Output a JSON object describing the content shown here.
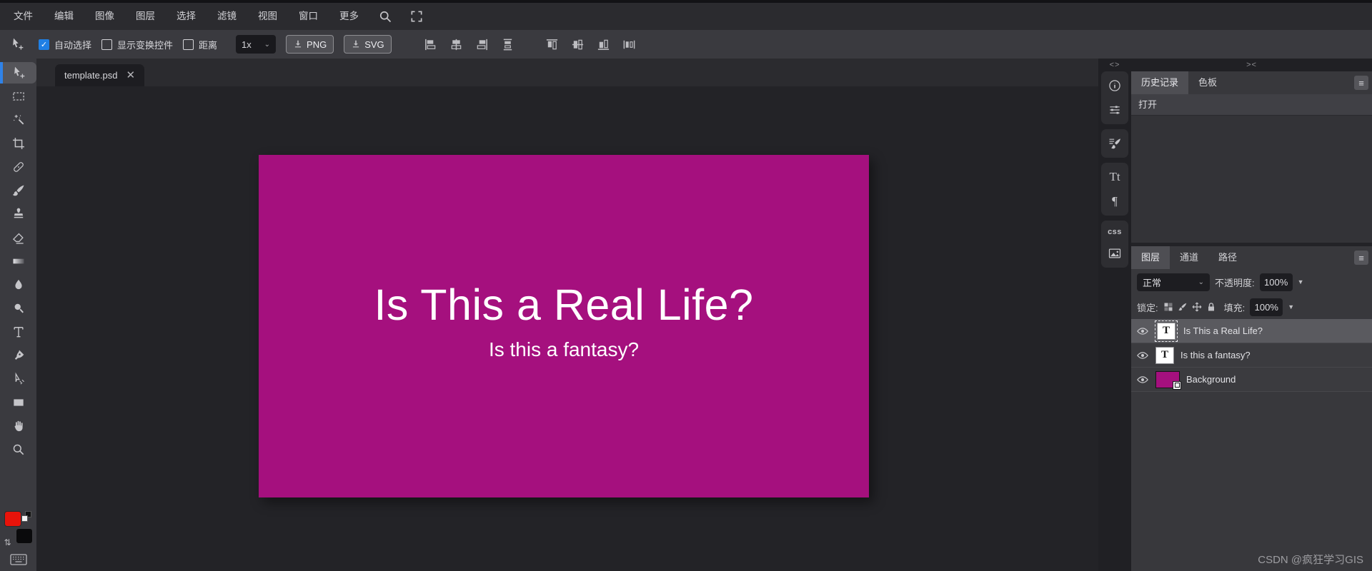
{
  "menubar": {
    "items": [
      "文件",
      "编辑",
      "图像",
      "图层",
      "选择",
      "滤镜",
      "视图",
      "窗口",
      "更多"
    ]
  },
  "options": {
    "auto_select_label": "自动选择",
    "transform_label": "显示变换控件",
    "distance_label": "距离",
    "scale_value": "1x",
    "png_label": "PNG",
    "svg_label": "SVG"
  },
  "tabs": {
    "document": "template.psd"
  },
  "toolbar": {
    "tools": [
      "move",
      "rect-select",
      "magic-wand",
      "crop",
      "spot-heal",
      "brush",
      "clone-stamp",
      "eraser",
      "gradient",
      "blur",
      "dodge",
      "type",
      "pen",
      "direct-select",
      "rectangle",
      "hand",
      "zoom"
    ],
    "foreground_color": "#e8130a",
    "background_color": "#0a0a0c"
  },
  "canvas": {
    "title": "Is This a Real Life?",
    "subtitle": "Is this a fantasy?",
    "background_color": "#a5107e",
    "text_color": "#ffffff"
  },
  "panels": {
    "collapse_left": "<>",
    "collapse_right": "><",
    "history": {
      "tab_history": "历史记录",
      "tab_swatches": "色板",
      "entry_open": "打开"
    },
    "strip": {
      "tt": "Tt",
      "paragraph": "¶",
      "css": "css"
    },
    "layers": {
      "tab_layers": "图层",
      "tab_channels": "通道",
      "tab_paths": "路径",
      "blend_mode": "正常",
      "opacity_label": "不透明度:",
      "opacity_value": "100%",
      "lock_label": "锁定:",
      "fill_label": "填充:",
      "fill_value": "100%",
      "items": [
        {
          "name": "Is This a Real Life?",
          "type": "text",
          "selected": true
        },
        {
          "name": "Is this a fantasy?",
          "type": "text",
          "selected": false
        },
        {
          "name": "Background",
          "type": "image",
          "selected": false
        }
      ]
    }
  },
  "watermark": "CSDN @疯狂学习GIS"
}
